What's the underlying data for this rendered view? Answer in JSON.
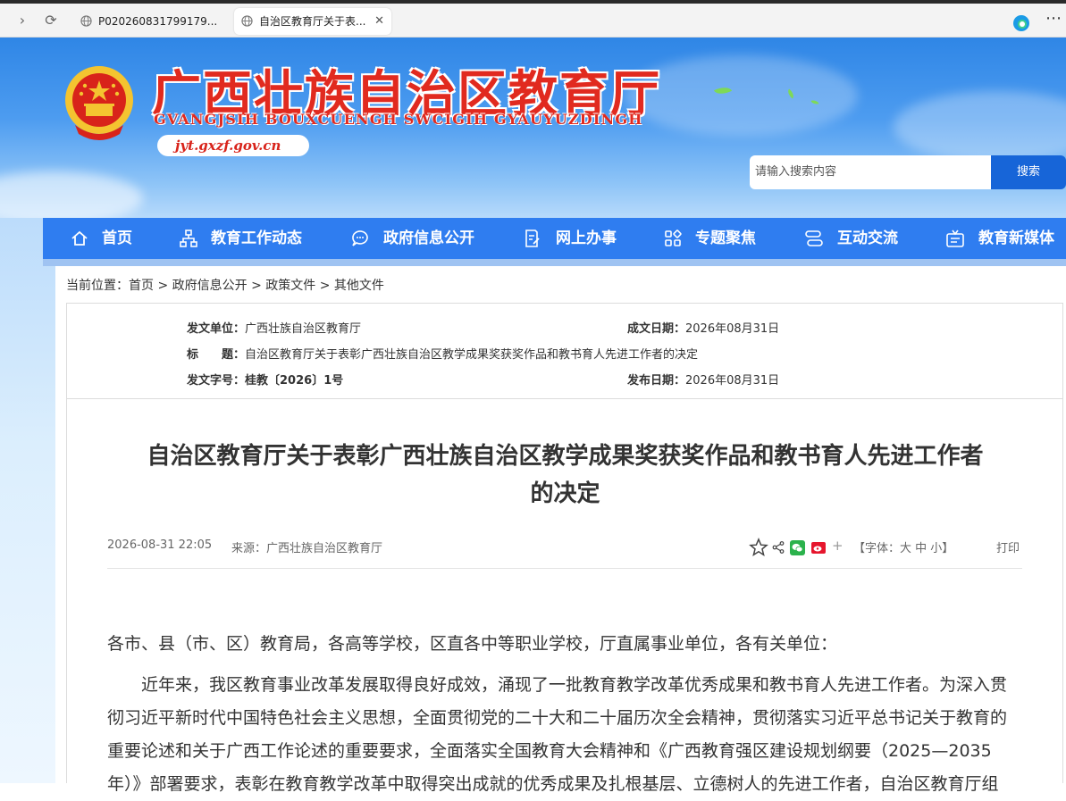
{
  "browser": {
    "tabs": [
      {
        "label": "P020260831799179..."
      },
      {
        "label": "自治区教育厅关于表..."
      }
    ]
  },
  "header": {
    "title": "广西壮族自治区教育厅",
    "subtitle": "GVANGJSIH BOUXCUENGH SWCIGIH GYAUYUZDINGH",
    "url": "jyt.gxzf.gov.cn",
    "search_placeholder": "请输入搜索内容",
    "search_button": "搜索"
  },
  "nav": [
    {
      "label": "首页",
      "icon": "home-icon"
    },
    {
      "label": "教育工作动态",
      "icon": "org-chart-icon"
    },
    {
      "label": "政府信息公开",
      "icon": "chat-bubble-icon"
    },
    {
      "label": "网上办事",
      "icon": "edit-doc-icon"
    },
    {
      "label": "专题聚焦",
      "icon": "grid-icon"
    },
    {
      "label": "互动交流",
      "icon": "exchange-icon"
    },
    {
      "label": "教育新媒体",
      "icon": "media-icon"
    }
  ],
  "breadcrumb": {
    "prefix": "当前位置：",
    "items": [
      "首页",
      "政府信息公开",
      "政策文件",
      "其他文件"
    ],
    "separator": ">"
  },
  "meta": {
    "issuer_label": "发文单位：",
    "issuer": "广西壮族自治区教育厅",
    "made_label": "成文日期：",
    "made_date": "2026年08月31日",
    "title_label": "标　　题：",
    "title": "自治区教育厅关于表彰广西壮族自治区教学成果奖获奖作品和教书育人先进工作者的决定",
    "doc_no_label": "发文字号：",
    "doc_no": "桂教〔2026〕1号",
    "publish_label": "发布日期：",
    "publish_date": "2026年08月31日"
  },
  "article": {
    "title_line1": "自治区教育厅关于表彰广西壮族自治区教学成果奖获奖作品和教书育人先进工作者",
    "title_line2": "的决定",
    "datetime": "2026-08-31 22:05",
    "source": "来源：广西壮族自治区教育厅",
    "font_size": "【字体：大 中 小】",
    "print": "打印",
    "salutation": "各市、县（市、区）教育局，各高等学校，区直各中等职业学校，厅直属事业单位，各有关单位：",
    "para1_line1": "　　近年来，我区教育事业改革发展取得良好成效，涌现了一批教育教学改革优秀成果和教书育人先进工作者。为深入贯",
    "para1_line2": "彻习近平新时代中国特色社会主义思想，全面贯彻党的二十大和二十届历次全会精神，贯彻落实习近平总书记关于教育的",
    "para1_line3": "重要论述和关于广西工作论述的重要要求，全面落实全国教育大会精神和《广西教育强区建设规划纲要（2025—2035",
    "para1_line4": "年）》部署要求，表彰在教育教学改革中取得突出成就的优秀成果及扎根基层、立德树人的先进工作者，自治区教育厅组"
  }
}
